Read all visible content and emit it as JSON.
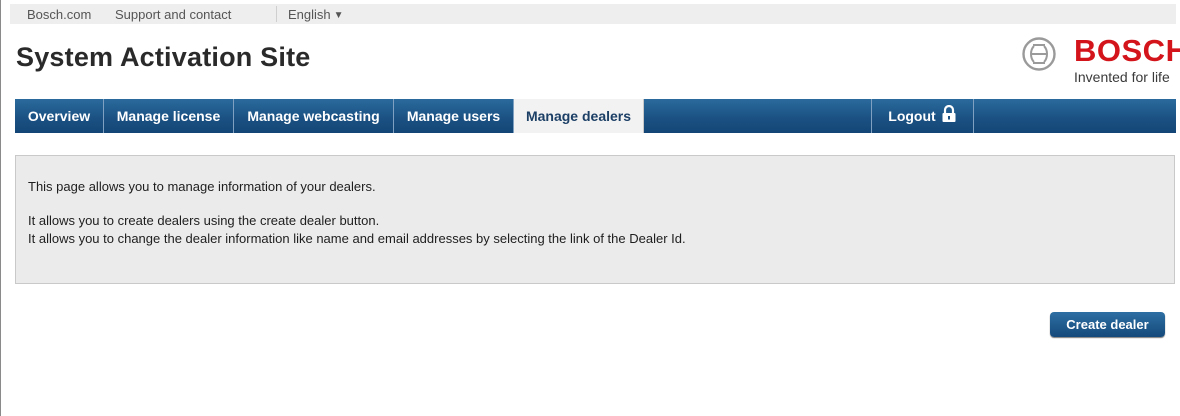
{
  "topbar": {
    "links": [
      "Bosch.com",
      "Support and contact"
    ],
    "language": "English"
  },
  "header": {
    "title": "System Activation Site",
    "brand_name": "BOSCH",
    "brand_tagline": "Invented for life",
    "brand_color": "#d3141b"
  },
  "nav": {
    "items": [
      "Overview",
      "Manage license",
      "Manage webcasting",
      "Manage users",
      "Manage dealers"
    ],
    "active": "Manage dealers",
    "logout_label": "Logout",
    "logout_icon": "lock-icon",
    "bar_color": "#1b5283"
  },
  "info": {
    "line1": "This page allows you to manage information of your dealers.",
    "line2": "It allows you to create dealers using the create dealer button.",
    "line3": "It allows you to change the dealer information like name and email addresses by selecting the link of the Dealer Id."
  },
  "actions": {
    "create_dealer_label": "Create dealer"
  }
}
